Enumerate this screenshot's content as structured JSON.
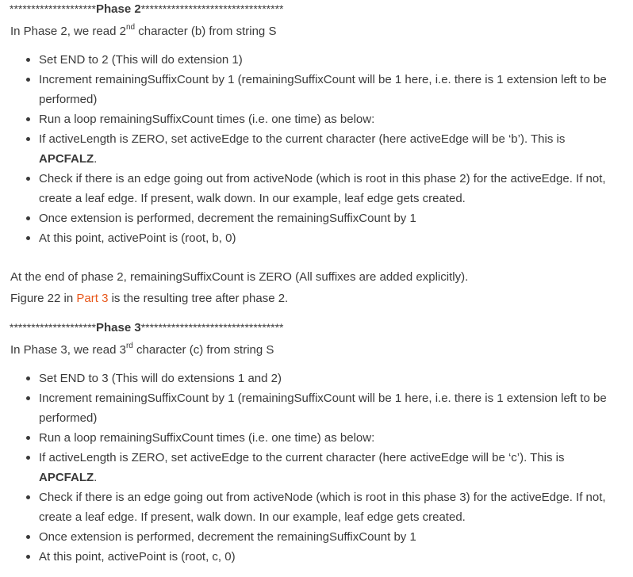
{
  "phase2": {
    "header_prefix": "********************",
    "header_title": "Phase 2",
    "header_suffix": "*********************************",
    "intro_a": "In Phase 2, we read 2",
    "intro_sup": "nd",
    "intro_b": " character (b) from string S",
    "bullets": [
      {
        "text": "Set END to 2 (This will do extension 1)"
      },
      {
        "text": "Increment remainingSuffixCount by 1 (remainingSuffixCount will be 1 here, i.e. there is 1 extension left to be performed)"
      },
      {
        "text": "Run a loop remainingSuffixCount times (i.e. one time) as below:"
      },
      {
        "text": "If activeLength is ZERO, set activeEdge to the current character (here activeEdge will be ‘b’). This is ",
        "strong": "APCFALZ",
        "tail": "."
      },
      {
        "text": "Check if there is an edge going out from activeNode (which is root in this phase 2) for the activeEdge. If not, create a leaf edge. If present, walk down. In our example, leaf edge gets created."
      },
      {
        "text": "Once extension is performed, decrement the remainingSuffixCount by 1"
      },
      {
        "text": "At this point, activePoint is (root, b, 0)"
      }
    ],
    "end_line": "At the end of phase 2, remainingSuffixCount is ZERO (All suffixes are added explicitly).",
    "figure_a": "Figure 22 in ",
    "figure_link": "Part 3",
    "figure_b": " is the resulting tree after phase 2."
  },
  "phase3": {
    "header_prefix": "********************",
    "header_title": "Phase 3",
    "header_suffix": "*********************************",
    "intro_a": "In Phase 3, we read 3",
    "intro_sup": "rd",
    "intro_b": " character (c) from string S",
    "bullets": [
      {
        "text": "Set END to 3 (This will do extensions 1 and 2)"
      },
      {
        "text": "Increment remainingSuffixCount by 1 (remainingSuffixCount will be 1 here, i.e. there is 1 extension left to be performed)"
      },
      {
        "text": "Run a loop remainingSuffixCount times (i.e. one time) as below:"
      },
      {
        "text": "If activeLength is ZERO, set activeEdge to the current character (here activeEdge will be ‘c’). This is ",
        "strong": "APCFALZ",
        "tail": "."
      },
      {
        "text": "Check if there is an edge going out from activeNode (which is root in this phase 3) for the activeEdge. If not, create a leaf edge. If present, walk down. In our example, leaf edge gets created."
      },
      {
        "text": "Once extension is performed, decrement the remainingSuffixCount by 1"
      },
      {
        "text": "At this point, activePoint is (root, c, 0)"
      }
    ]
  },
  "colors": {
    "text": "#3a3a3a",
    "link": "#e8581c"
  }
}
